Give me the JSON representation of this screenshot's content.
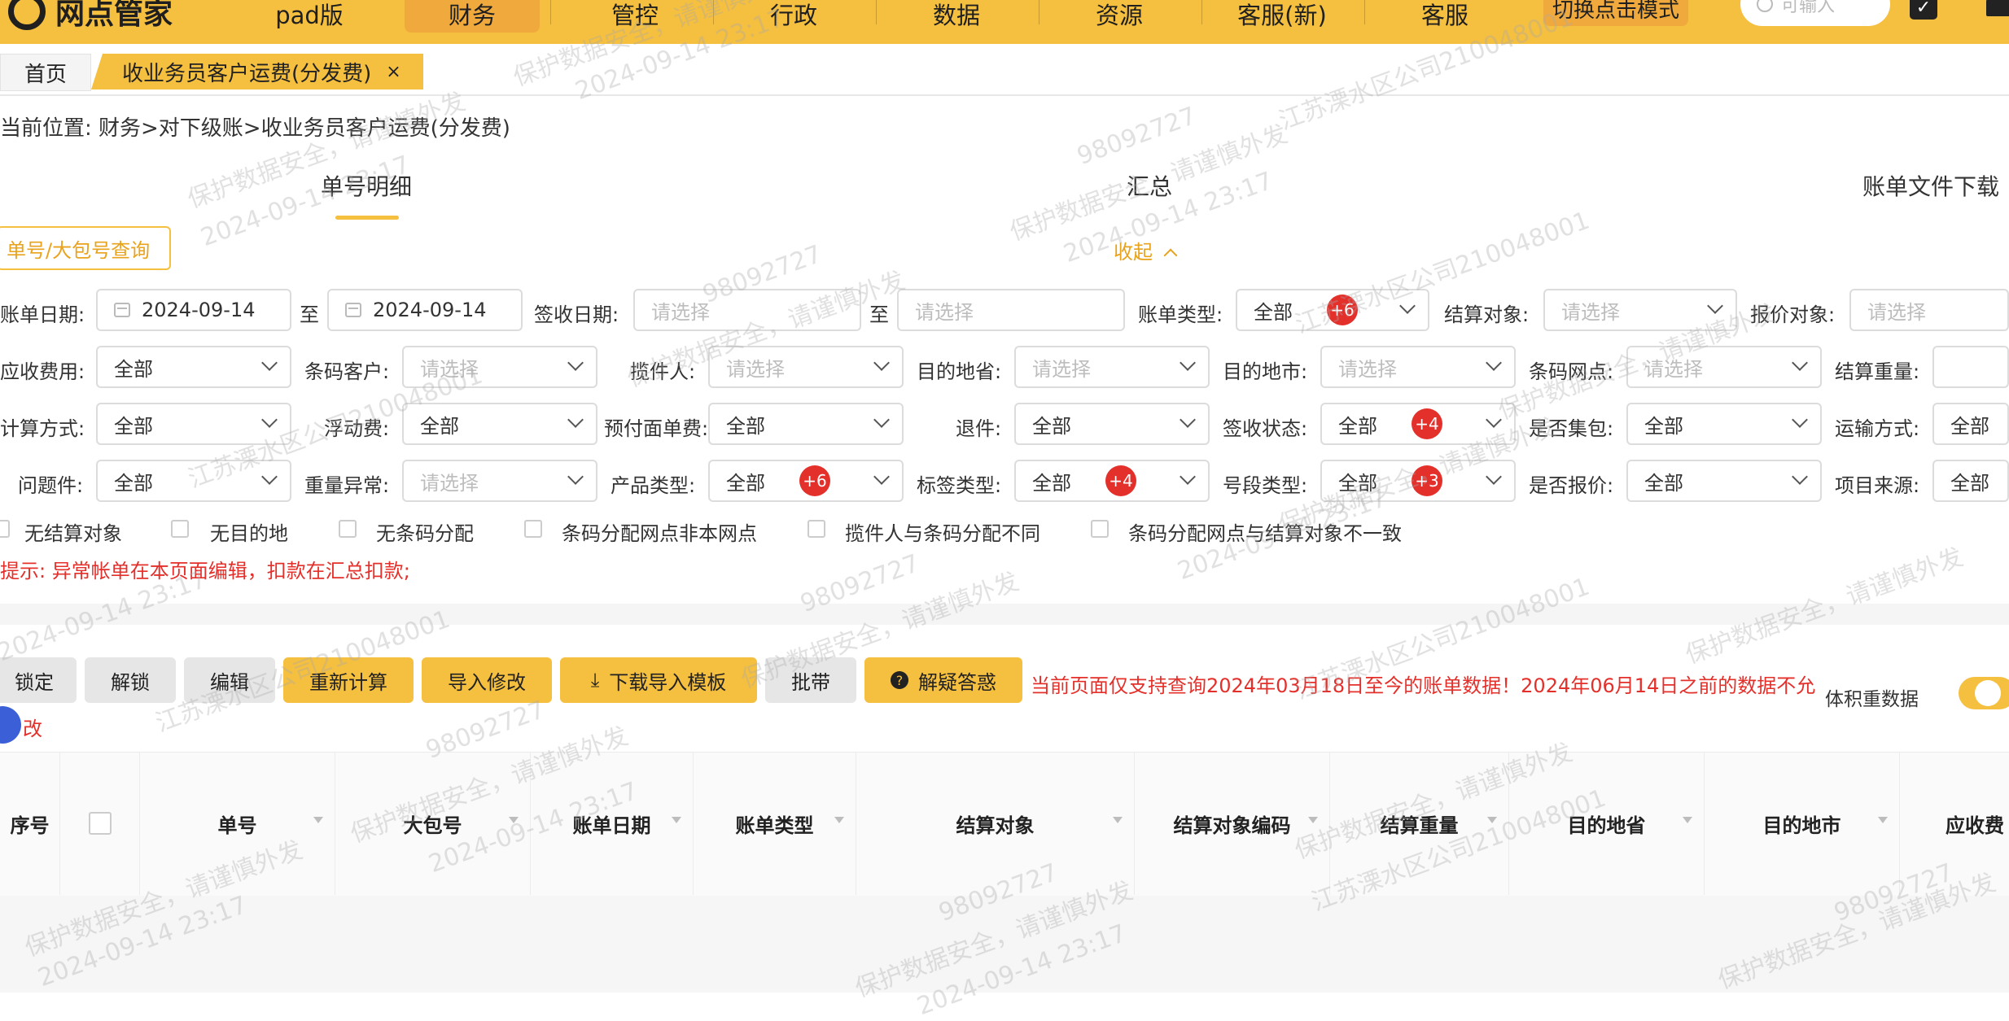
{
  "app": {
    "logo_text": "网点管家"
  },
  "nav": {
    "items": [
      "pad版",
      "财务",
      "管控",
      "行政",
      "数据",
      "资源",
      "客服(新)",
      "客服"
    ],
    "active": "财务",
    "mode_button": "切换点击模式",
    "search_placeholder": "可输入"
  },
  "tabs": {
    "home": "首页",
    "current": "收业务员客户运费(分发费)",
    "close_glyph": "×"
  },
  "breadcrumb": "当前位置: 财务>对下级账>收业务员客户运费(分发费)",
  "subtabs": {
    "detail": "单号明细",
    "summary": "汇总",
    "download": "账单文件下载"
  },
  "query_button": "单号/大包号查询",
  "collapse_label": "收起",
  "filters": {
    "bill_date": {
      "label": "账单日期:",
      "start": "2024-09-14",
      "end": "2024-09-14",
      "to": "至"
    },
    "sign_date": {
      "label": "签收日期:",
      "start": "请选择",
      "end": "请选择",
      "to": "至"
    },
    "bill_type": {
      "label": "账单类型:",
      "value": "全部",
      "badge": "+6"
    },
    "settle_obj": {
      "label": "结算对象:",
      "value": "请选择"
    },
    "quote_obj": {
      "label": "报价对象:",
      "value": "请选择"
    },
    "receivable": {
      "label": "应收费用:",
      "value": "全部"
    },
    "barcode_customer": {
      "label": "条码客户:",
      "value": "请选择"
    },
    "collector": {
      "label": "揽件人:",
      "value": "请选择"
    },
    "dest_province": {
      "label": "目的地省:",
      "value": "请选择"
    },
    "dest_city": {
      "label": "目的地市:",
      "value": "请选择"
    },
    "barcode_outlet": {
      "label": "条码网点:",
      "value": "请选择"
    },
    "settle_weight": {
      "label": "结算重量:",
      "value": ""
    },
    "calc_method": {
      "label": "计算方式:",
      "value": "全部"
    },
    "float_fee": {
      "label": "浮动费:",
      "value": "全部"
    },
    "prepay_fee": {
      "label": "预付面单费:",
      "value": "全部"
    },
    "return": {
      "label": "退件:",
      "value": "全部"
    },
    "sign_status": {
      "label": "签收状态:",
      "value": "全部",
      "badge": "+4"
    },
    "is_bundle": {
      "label": "是否集包:",
      "value": "全部"
    },
    "transport": {
      "label": "运输方式:",
      "value": "全部"
    },
    "problem": {
      "label": "问题件:",
      "value": "全部"
    },
    "weight_abnormal": {
      "label": "重量异常:",
      "value": "请选择"
    },
    "product_type": {
      "label": "产品类型:",
      "value": "全部",
      "badge": "+6"
    },
    "label_type": {
      "label": "标签类型:",
      "value": "全部",
      "badge": "+4"
    },
    "segment_type": {
      "label": "号段类型:",
      "value": "全部",
      "badge": "+3"
    },
    "is_quoted": {
      "label": "是否报价:",
      "value": "全部"
    },
    "project_source": {
      "label": "项目来源:",
      "value": "全部"
    }
  },
  "checkboxes": [
    "无结算对象",
    "无目的地",
    "无条码分配",
    "条码分配网点非本网点",
    "揽件人与条码分配不同",
    "条码分配网点与结算对象不一致"
  ],
  "tip": "提示: 异常帐单在本页面编辑，扣款在汇总扣款;",
  "actions": {
    "lock": "锁定",
    "unlock": "解锁",
    "edit": "编辑",
    "recalc": "重新计算",
    "import_edit": "导入修改",
    "download_template": "下载导入模板",
    "batch": "批带",
    "faq": "解疑答惑",
    "warning": "当前页面仅支持查询2024年03月18日至今的账单数据！2024年06月14日之前的数据不允",
    "volume_label": "体积重数据",
    "fix_text": "改"
  },
  "table": {
    "columns": [
      "序号",
      "",
      "单号",
      "大包号",
      "账单日期",
      "账单类型",
      "结算对象",
      "结算对象编码",
      "结算重量",
      "目的地省",
      "目的地市",
      "应收费"
    ]
  },
  "watermark": {
    "line1": "98092727",
    "line2": "保护数据安全，请谨慎外发",
    "line3": "2024-09-14 23:17",
    "line4": "江苏溧水区公司210048001"
  },
  "colors": {
    "brand": "#f5bf3f",
    "accent_dark": "#e9a21c",
    "danger": "#e4302b"
  }
}
